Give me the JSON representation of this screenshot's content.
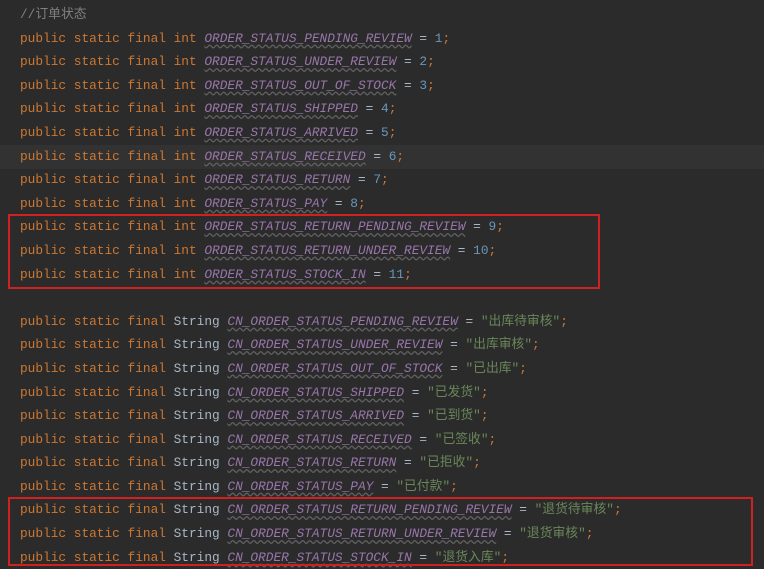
{
  "comment": "//订单状态",
  "kw": {
    "public": "public",
    "static": "static",
    "final": "final",
    "int": "int"
  },
  "string_type": "String",
  "ints": [
    {
      "name": "ORDER_STATUS_PENDING_REVIEW",
      "val": "1"
    },
    {
      "name": "ORDER_STATUS_UNDER_REVIEW",
      "val": "2"
    },
    {
      "name": "ORDER_STATUS_OUT_OF_STOCK",
      "val": "3"
    },
    {
      "name": "ORDER_STATUS_SHIPPED",
      "val": "4"
    },
    {
      "name": "ORDER_STATUS_ARRIVED",
      "val": "5"
    },
    {
      "name": "ORDER_STATUS_RECEIVED",
      "val": "6"
    },
    {
      "name": "ORDER_STATUS_RETURN",
      "val": "7"
    },
    {
      "name": "ORDER_STATUS_PAY",
      "val": "8"
    },
    {
      "name": "ORDER_STATUS_RETURN_PENDING_REVIEW",
      "val": "9"
    },
    {
      "name": "ORDER_STATUS_RETURN_UNDER_REVIEW",
      "val": "10"
    },
    {
      "name": "ORDER_STATUS_STOCK_IN",
      "val": "11"
    }
  ],
  "strings": [
    {
      "name": "CN_ORDER_STATUS_PENDING_REVIEW",
      "val": "\"出库待审核\""
    },
    {
      "name": "CN_ORDER_STATUS_UNDER_REVIEW",
      "val": "\"出库审核\""
    },
    {
      "name": "CN_ORDER_STATUS_OUT_OF_STOCK",
      "val": "\"已出库\""
    },
    {
      "name": "CN_ORDER_STATUS_SHIPPED",
      "val": "\"已发货\""
    },
    {
      "name": "CN_ORDER_STATUS_ARRIVED",
      "val": "\"已到货\""
    },
    {
      "name": "CN_ORDER_STATUS_RECEIVED",
      "val": "\"已签收\""
    },
    {
      "name": "CN_ORDER_STATUS_RETURN",
      "val": "\"已拒收\""
    },
    {
      "name": "CN_ORDER_STATUS_PAY",
      "val": "\"已付款\""
    },
    {
      "name": "CN_ORDER_STATUS_RETURN_PENDING_REVIEW",
      "val": "\"退货待审核\""
    },
    {
      "name": "CN_ORDER_STATUS_RETURN_UNDER_REVIEW",
      "val": "\"退货审核\""
    },
    {
      "name": "CN_ORDER_STATUS_STOCK_IN",
      "val": "\"退货入库\""
    }
  ]
}
